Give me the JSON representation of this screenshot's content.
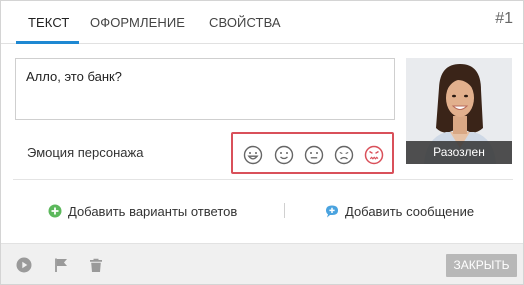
{
  "tabs": [
    {
      "label": "ТЕКСТ",
      "active": true
    },
    {
      "label": "ОФОРМЛЕНИЕ",
      "active": false
    },
    {
      "label": "СВОЙСТВА",
      "active": false
    }
  ],
  "card_number": "#1",
  "text_box": {
    "value": "Алло, это банк?"
  },
  "emotion": {
    "label": "Эмоция персонажа",
    "options": [
      "happy-face-icon",
      "smile-face-icon",
      "neutral-face-icon",
      "sad-face-icon",
      "angry-face-icon"
    ],
    "selected": "angry",
    "highlight_color": "#d9505a"
  },
  "avatar": {
    "caption": "Разозлен"
  },
  "actions": {
    "add_answers": "Добавить варианты ответов",
    "add_message": "Добавить сообщение"
  },
  "footer": {
    "close_label": "ЗАКРЫТЬ",
    "icons": [
      "play-icon",
      "flag-icon",
      "trash-icon"
    ]
  },
  "colors": {
    "accent": "#1e88d2",
    "add_green": "#5cb85c",
    "message_blue": "#4aa3df",
    "angry_red": "#d9505a"
  }
}
